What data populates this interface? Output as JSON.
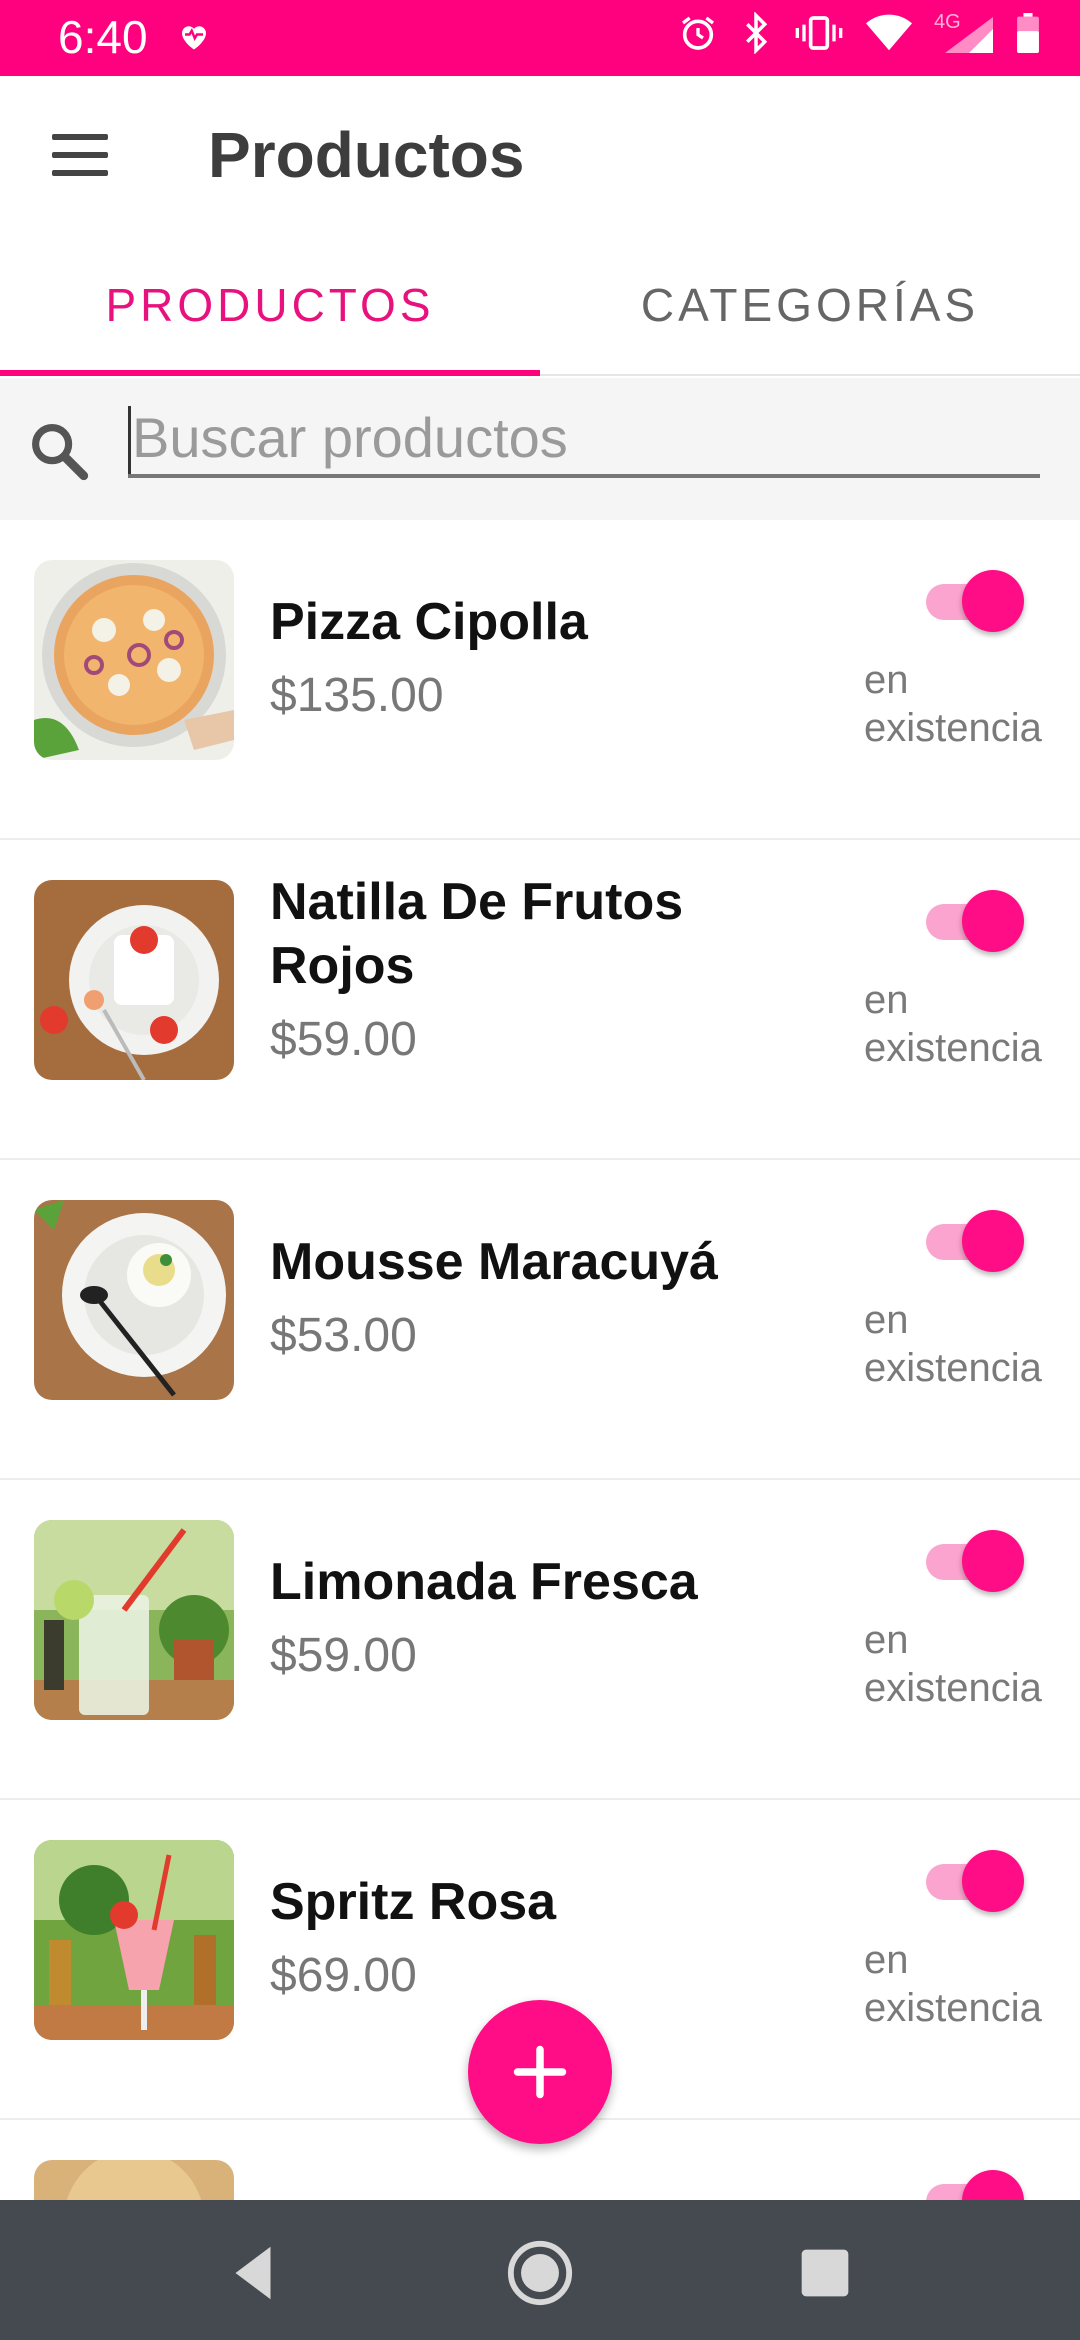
{
  "status_bar": {
    "time": "6:40",
    "icons": [
      "heart-pulse-icon",
      "alarm-icon",
      "bluetooth-icon",
      "vibrate-icon",
      "wifi-icon",
      "signal-4g-icon",
      "battery-icon"
    ],
    "network_label": "4G",
    "background_color": "#ff007f"
  },
  "app_bar": {
    "title": "Productos",
    "menu_icon": "hamburger-menu-icon"
  },
  "tabs": [
    {
      "label": "PRODUCTOS",
      "selected": true
    },
    {
      "label": "CATEGORÍAS",
      "selected": false
    }
  ],
  "search": {
    "placeholder": "Buscar productos",
    "value": ""
  },
  "products": [
    {
      "name": "Pizza Cipolla",
      "price": "$135.00",
      "in_stock": true,
      "stock_label": "en existencia"
    },
    {
      "name": "Natilla De Frutos Rojos",
      "price": "$59.00",
      "in_stock": true,
      "stock_label": "en existencia"
    },
    {
      "name": "Mousse Maracuyá",
      "price": "$53.00",
      "in_stock": true,
      "stock_label": "en existencia"
    },
    {
      "name": "Limonada Fresca",
      "price": "$59.00",
      "in_stock": true,
      "stock_label": "en existencia"
    },
    {
      "name": "Spritz Rosa",
      "price": "$69.00",
      "in_stock": true,
      "stock_label": "en existencia"
    },
    {
      "name": "",
      "price": "",
      "in_stock": true,
      "stock_label": ""
    }
  ],
  "fab": {
    "icon": "plus-icon"
  },
  "nav_bar": {
    "icons": [
      "back-icon",
      "home-icon",
      "recents-icon"
    ]
  },
  "colors": {
    "accent": "#ff007f",
    "toggle_thumb": "#ff0d86",
    "toggle_track": "#fba4cf",
    "tab_selected": "#e8127e",
    "nav_bar": "#454950"
  }
}
